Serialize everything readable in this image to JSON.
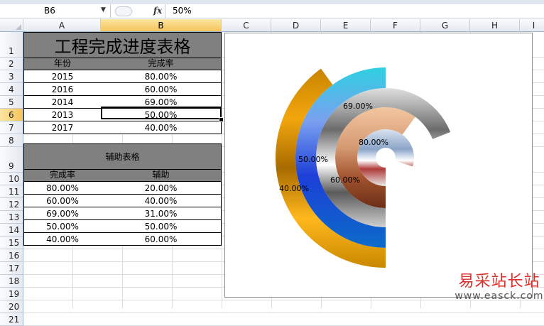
{
  "formula_bar": {
    "name_box": "B6",
    "fx_label": "fx",
    "content": "50%"
  },
  "columns": [
    "A",
    "B",
    "C",
    "D",
    "E",
    "F",
    "G",
    "H",
    "I"
  ],
  "rows": [
    "1",
    "2",
    "3",
    "4",
    "5",
    "6",
    "7",
    "8",
    "9",
    "10",
    "11",
    "12",
    "13",
    "14",
    "15",
    "16",
    "17",
    "18",
    "19",
    "20",
    "21"
  ],
  "selection": {
    "column": "B",
    "row": "6"
  },
  "table1": {
    "title": "工程完成进度表格",
    "header_year": "年份",
    "header_rate": "完成率",
    "rows": [
      {
        "year": "2015",
        "rate": "80.00%"
      },
      {
        "year": "2016",
        "rate": "60.00%"
      },
      {
        "year": "2014",
        "rate": "69.00%"
      },
      {
        "year": "2013",
        "rate": "50.00%"
      },
      {
        "year": "2017",
        "rate": "40.00%"
      }
    ]
  },
  "table2": {
    "title": "辅助表格",
    "header_rate": "完成率",
    "header_aux": "辅助",
    "rows": [
      {
        "rate": "80.00%",
        "aux": "20.00%"
      },
      {
        "rate": "60.00%",
        "aux": "40.00%"
      },
      {
        "rate": "69.00%",
        "aux": "31.00%"
      },
      {
        "rate": "50.00%",
        "aux": "50.00%"
      },
      {
        "rate": "40.00%",
        "aux": "60.00%"
      }
    ]
  },
  "chart_data": {
    "type": "doughnut",
    "start_angle_deg": 180,
    "rings_inner_to_outer": [
      {
        "value": 0.8,
        "label": "80.00%"
      },
      {
        "value": 0.6,
        "label": "60.00%"
      },
      {
        "value": 0.69,
        "label": "69.00%"
      },
      {
        "value": 0.5,
        "label": "50.00%"
      },
      {
        "value": 0.4,
        "label": "40.00%"
      }
    ]
  },
  "watermark": {
    "text": "易采站长站",
    "url": "www.easck.com"
  }
}
